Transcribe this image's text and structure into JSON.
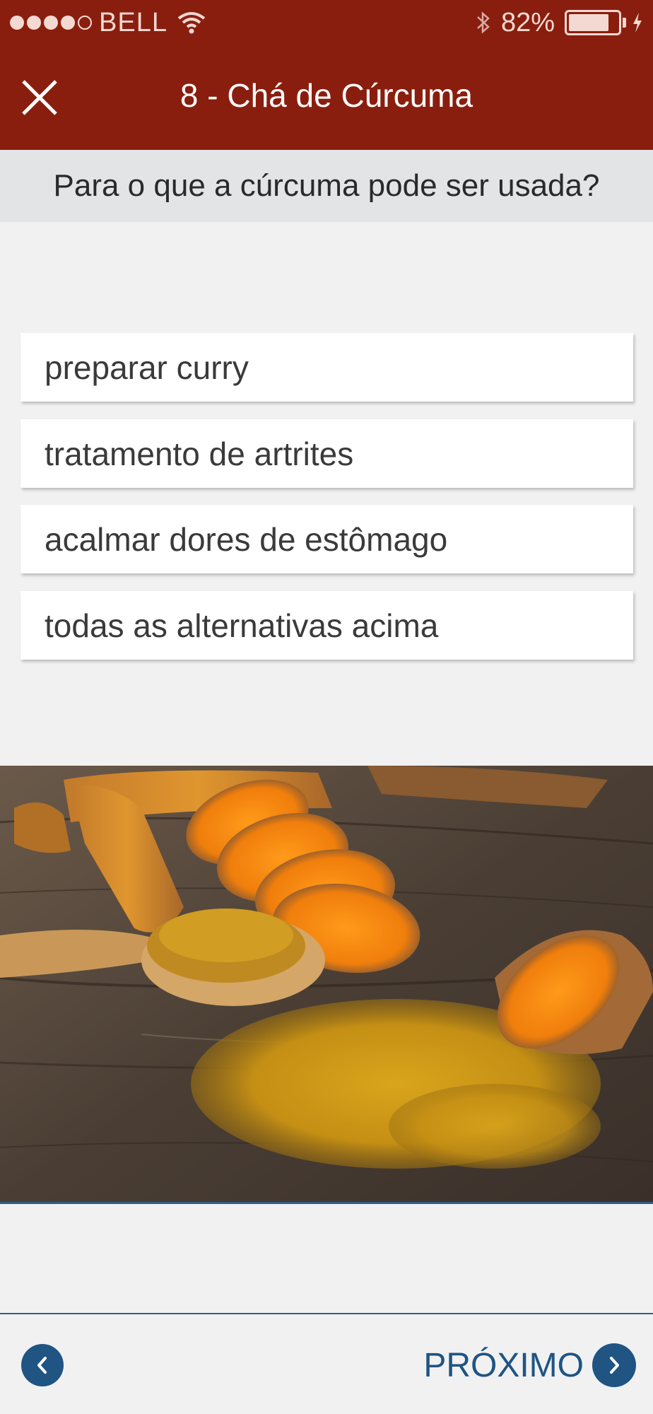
{
  "status_bar": {
    "carrier": "BELL",
    "battery_percent": "82%",
    "battery_level": 0.82,
    "signal_bars": 4,
    "signal_total": 5,
    "icons": [
      "wifi-icon",
      "bluetooth-icon",
      "battery-icon",
      "charging-icon"
    ]
  },
  "nav": {
    "title": "8 - Chá de Cúrcuma",
    "close_icon": "close-icon"
  },
  "question": {
    "text": "Para o que a cúrcuma pode ser usada?"
  },
  "answers": [
    {
      "label": "preparar curry"
    },
    {
      "label": "tratamento de artrites"
    },
    {
      "label": "acalmar dores de estômago"
    },
    {
      "label": "todas as alternativas acima"
    }
  ],
  "footer": {
    "next_label": "PRÓXIMO",
    "prev_icon": "chevron-left-icon",
    "next_icon": "chevron-right-icon"
  },
  "colors": {
    "header": "#8a1e0e",
    "accent": "#1f5483",
    "background": "#f1f1f2"
  }
}
